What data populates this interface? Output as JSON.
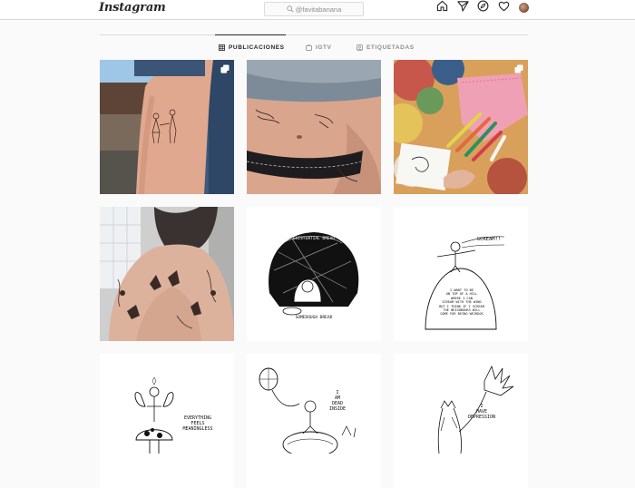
{
  "header": {
    "logo": "Instagram",
    "search_text": "@favitabanana",
    "icons": [
      "home-icon",
      "direct-icon",
      "explore-icon",
      "activity-heart-icon",
      "profile-avatar"
    ]
  },
  "tabs": [
    {
      "label": "PUBLICACIONES",
      "icon": "grid-icon",
      "active": true
    },
    {
      "label": "IGTV",
      "icon": "igtv-icon",
      "active": false
    },
    {
      "label": "ETIQUETADAS",
      "icon": "tagged-icon",
      "active": false
    }
  ],
  "posts": [
    {
      "id": "post-1",
      "kind": "photo",
      "subject": "arm tattoo of two figures",
      "multiple": true
    },
    {
      "id": "post-2",
      "kind": "photo",
      "subject": "belly tattoos",
      "multiple": false
    },
    {
      "id": "post-3",
      "kind": "photo",
      "subject": "markers and pink pouch",
      "multiple": true
    },
    {
      "id": "post-4",
      "kind": "photo",
      "subject": "tattooed torso",
      "multiple": false
    },
    {
      "id": "post-5",
      "kind": "drawing",
      "caption": "EXISTENTIAL DREAD",
      "subcaption": "SOMEDOUGH BREAD",
      "multiple": false
    },
    {
      "id": "post-6",
      "kind": "drawing",
      "caption": "SCREAM!!",
      "subcaption": "I WANT TO BE\nON TOP OF A HILL\nWHERE I CAN\nSCREAM WITH THE WIND\nBUT I THINK IF I SCREAM\nTHE NEIGHBOURS WILL\nCOME FOR BEING WEIRDOS",
      "multiple": false
    },
    {
      "id": "post-7",
      "kind": "drawing",
      "caption": "EVERYTHING\nFEELS\nMEANINGLESS",
      "multiple": false
    },
    {
      "id": "post-8",
      "kind": "drawing",
      "caption": "I\nAM\nDEAD\nINSIDE",
      "multiple": false
    },
    {
      "id": "post-9",
      "kind": "drawing",
      "caption": "I\nHAVE\nDEPRESSION",
      "multiple": false
    }
  ],
  "colors": {
    "background": "#fafafa",
    "border": "#dbdbdb",
    "text": "#262626",
    "muted": "#8e8e8e"
  }
}
